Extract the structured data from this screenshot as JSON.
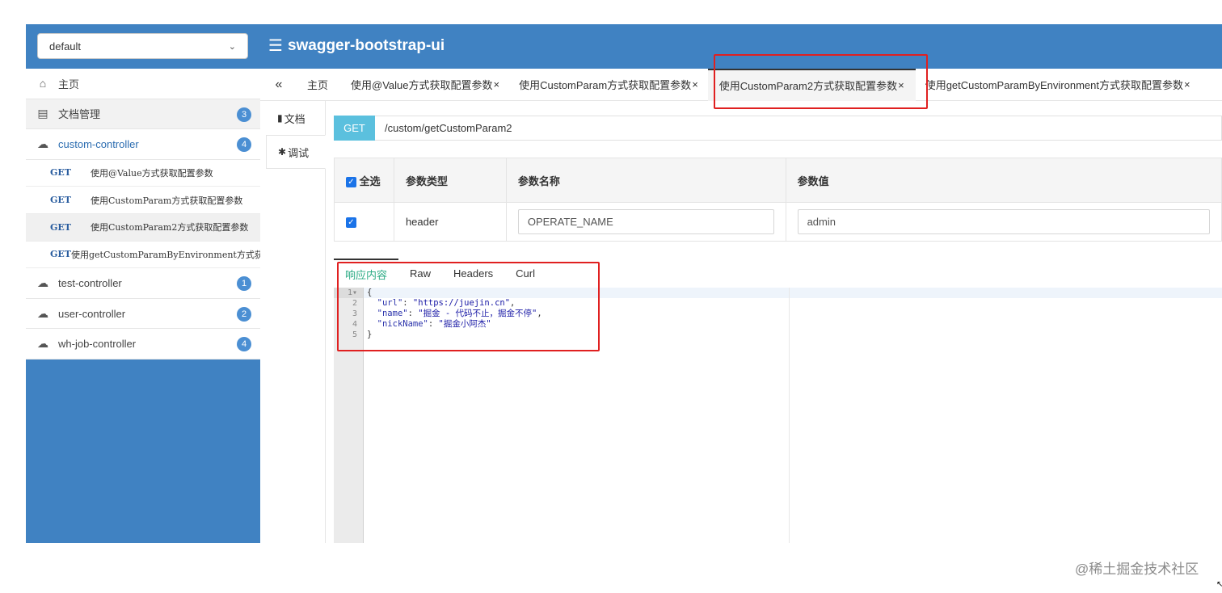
{
  "header": {
    "group_select": "default",
    "brand_title": "swagger-bootstrap-ui",
    "colors": {
      "header_bg": "#4082c2",
      "method_badge": "#5bc0de",
      "highlight": "#e02020",
      "active_resp_tab": "#2bab84"
    }
  },
  "sidebar": {
    "home": "主页",
    "doc_manage": {
      "label": "文档管理",
      "count": "3"
    },
    "controllers_top": {
      "label": "custom-controller",
      "count": "4"
    },
    "apis": [
      {
        "method": "GET",
        "label": "使用@Value方式获取配置参数"
      },
      {
        "method": "GET",
        "label": "使用CustomParam方式获取配置参数"
      },
      {
        "method": "GET",
        "label": "使用CustomParam2方式获取配置参数"
      },
      {
        "method": "GET",
        "label": "使用getCustomParamByEnvironment方式获取"
      }
    ],
    "controllers": [
      {
        "label": "test-controller",
        "count": "1"
      },
      {
        "label": "user-controller",
        "count": "2"
      },
      {
        "label": "wh-job-controller",
        "count": "4"
      }
    ]
  },
  "tabs": {
    "collapse": "«",
    "home": "主页",
    "items": [
      {
        "label": "使用@Value方式获取配置参数",
        "close": "×"
      },
      {
        "label": "使用CustomParam方式获取配置参数",
        "close": "×"
      },
      {
        "label": "使用CustomParam2方式获取配置参数",
        "close": "×"
      },
      {
        "label": "使用getCustomParamByEnvironment方式获取配置参数",
        "close": "×"
      }
    ]
  },
  "subnav": {
    "doc": "文档",
    "debug": "调试"
  },
  "request": {
    "method": "GET",
    "url": "/custom/getCustomParam2"
  },
  "params": {
    "select_all": "全选",
    "col_type": "参数类型",
    "col_name": "参数名称",
    "col_value": "参数值",
    "rows": [
      {
        "type": "header",
        "name": "OPERATE_NAME",
        "value": "admin"
      }
    ]
  },
  "response": {
    "tabs": [
      "响应内容",
      "Raw",
      "Headers",
      "Curl"
    ],
    "line_numbers": [
      "1",
      "2",
      "3",
      "4",
      "5"
    ],
    "fold_marker": "▾",
    "open_brace": "{",
    "close_brace": "}",
    "fields": [
      {
        "key": "\"url\"",
        "value": "\"https://juejin.cn\"",
        "sep": ","
      },
      {
        "key": "\"name\"",
        "value": "\"掘金 - 代码不止，掘金不停\"",
        "sep": ","
      },
      {
        "key": "\"nickName\"",
        "value": "\"掘金小阿杰\"",
        "sep": ""
      }
    ]
  },
  "watermark": "@稀土掘金技术社区"
}
